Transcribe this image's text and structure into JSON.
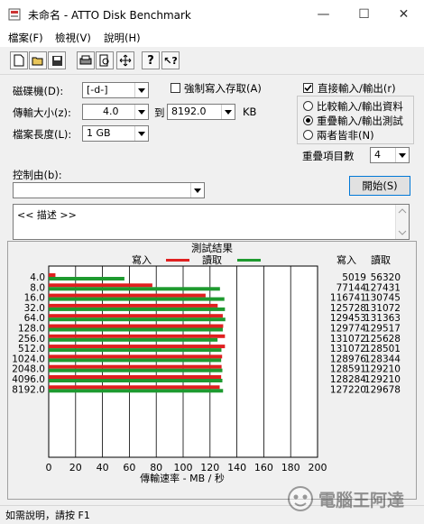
{
  "window": {
    "title": "未命名 - ATTO Disk Benchmark"
  },
  "menu": [
    "檔案(F)",
    "檢視(V)",
    "說明(H)"
  ],
  "toolbar": [
    "new-icon",
    "open-icon",
    "save-icon",
    "print-icon",
    "print-preview-icon",
    "move-icon",
    "help-icon",
    "context-help-icon"
  ],
  "settings": {
    "drive_label": "磁碟機(D):",
    "drive_value": "[-d-]",
    "transfer_label": "傳輸大小(z):",
    "transfer_from": "4.0",
    "to_label": "到",
    "transfer_to": "8192.0",
    "unit": "KB",
    "file_label": "檔案長度(L):",
    "file_value": "1 GB",
    "force_write_label": "強制寫入存取(A)",
    "force_write_checked": false,
    "direct_io_label": "直接輸入/輸出(r)",
    "direct_io_checked": true,
    "radio_compare": "比較輸入/輸出資料",
    "radio_overlap": "重疊輸入/輸出測試",
    "radio_neither": "兩者皆非(N)",
    "selected_radio": "overlap",
    "queue_label": "重疊項目數",
    "queue_value": "4",
    "start_button": "開始(S)",
    "control_label": "控制由(b):",
    "control_value": "",
    "description": "<< 描述 >>"
  },
  "chart_data": {
    "type": "bar",
    "title": "測試結果",
    "xlabel": "傳輸速率 - MB / 秒",
    "xlim": [
      0,
      200
    ],
    "xticks": [
      "0",
      "20",
      "40",
      "60",
      "80",
      "100",
      "120",
      "140",
      "160",
      "180",
      "200"
    ],
    "categories": [
      "4.0",
      "8.0",
      "16.0",
      "32.0",
      "64.0",
      "128.0",
      "256.0",
      "512.0",
      "1024.0",
      "2048.0",
      "4096.0",
      "8192.0"
    ],
    "series": [
      {
        "name": "寫入",
        "color": "#e02020",
        "values": [
          5.0,
          77.1,
          116.7,
          125.7,
          129.5,
          129.8,
          131.1,
          131.1,
          129.0,
          128.6,
          128.3,
          127.2
        ],
        "raw": [
          "5019",
          "77144",
          "116741",
          "125728",
          "129453",
          "129774",
          "131072",
          "131072",
          "128976",
          "128591",
          "128284",
          "127220"
        ]
      },
      {
        "name": "讀取",
        "color": "#1e9a2f",
        "values": [
          56.3,
          127.4,
          130.7,
          131.1,
          131.4,
          129.5,
          125.6,
          128.5,
          128.3,
          129.2,
          129.2,
          129.7
        ],
        "raw": [
          "56320",
          "127431",
          "130745",
          "131072",
          "131363",
          "129517",
          "125628",
          "128501",
          "128344",
          "129210",
          "129210",
          "129678"
        ]
      }
    ],
    "table_headers": [
      "寫入",
      "讀取"
    ],
    "grid": true,
    "legend": "top-center"
  },
  "status": {
    "text": "如需說明，請按 F1"
  },
  "watermark": "電腦王阿達"
}
